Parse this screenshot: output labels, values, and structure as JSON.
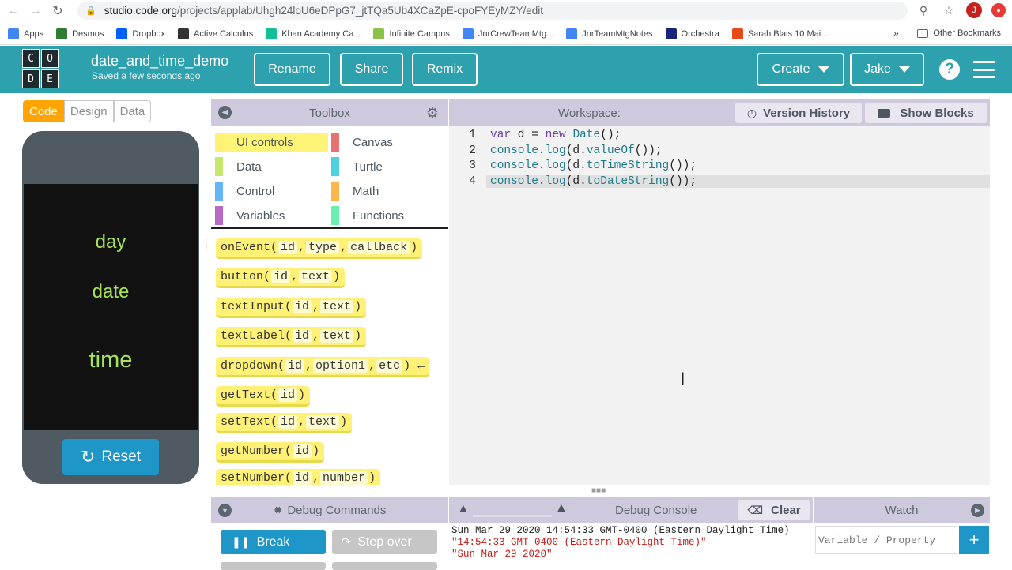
{
  "browser": {
    "url_host": "studio.code.org",
    "url_path": "/projects/applab/Uhgh24loU6eDPpG7_jtTQa5Ub4XCaZpE-cpoFYEyMZY/edit",
    "avatar_letter": "J"
  },
  "bookmarks": [
    {
      "label": "Apps",
      "color": "#4285f4"
    },
    {
      "label": "Desmos",
      "color": "#2e7d32"
    },
    {
      "label": "Dropbox",
      "color": "#0061fe"
    },
    {
      "label": "Active Calculus",
      "color": "#333333"
    },
    {
      "label": "Khan Academy Ca...",
      "color": "#14bf96"
    },
    {
      "label": "Infinite Campus",
      "color": "#8bc34a"
    },
    {
      "label": "JnrCrewTeamMtg...",
      "color": "#4285f4"
    },
    {
      "label": "JnrTeamMtgNotes",
      "color": "#4285f4"
    },
    {
      "label": "Orchestra",
      "color": "#1a237e"
    },
    {
      "label": "Sarah Blais 10 Mai...",
      "color": "#e64a19"
    }
  ],
  "bookmarks_more": "»",
  "other_bookmarks": "Other Bookmarks",
  "app": {
    "logo_letters": [
      "C",
      "O",
      "D",
      "E"
    ],
    "project_name": "date_and_time_demo",
    "saved_status": "Saved a few seconds ago",
    "rename_label": "Rename",
    "share_label": "Share",
    "remix_label": "Remix",
    "create_label": "Create",
    "user_label": "Jake",
    "help_label": "?"
  },
  "mode_tabs": [
    "Code",
    "Design",
    "Data"
  ],
  "phone": {
    "labels": [
      "day",
      "date",
      "time"
    ],
    "reset_label": "Reset"
  },
  "toolbox": {
    "title": "Toolbox",
    "categories": [
      {
        "label": "UI controls",
        "color": "#fff176"
      },
      {
        "label": "Canvas",
        "color": "#e57373"
      },
      {
        "label": "Data",
        "color": "#c5e86c"
      },
      {
        "label": "Turtle",
        "color": "#4dd0e1"
      },
      {
        "label": "Control",
        "color": "#64b5f6"
      },
      {
        "label": "Math",
        "color": "#ffb74d"
      },
      {
        "label": "Variables",
        "color": "#ba68c8"
      },
      {
        "label": "Functions",
        "color": "#69f0ae"
      }
    ],
    "blocks": [
      {
        "fn": "onEvent(",
        "args": [
          "id",
          "type",
          "callback"
        ],
        "end": ")"
      },
      {
        "fn": "button(",
        "args": [
          "id",
          "text"
        ],
        "end": ")"
      },
      {
        "fn": "textInput(",
        "args": [
          "id",
          "text"
        ],
        "end": ")"
      },
      {
        "fn": "textLabel(",
        "args": [
          "id",
          "text"
        ],
        "end": ")"
      },
      {
        "fn": "dropdown(",
        "args": [
          "id",
          "option1",
          "etc"
        ],
        "end": ") ←"
      },
      {
        "fn": "getText(",
        "args": [
          "id"
        ],
        "end": ")"
      },
      {
        "fn": "setText(",
        "args": [
          "id",
          "text"
        ],
        "end": ")"
      },
      {
        "fn": "getNumber(",
        "args": [
          "id"
        ],
        "end": ")"
      },
      {
        "fn": "setNumber(",
        "args": [
          "id",
          "number"
        ],
        "end": ")"
      }
    ]
  },
  "workspace": {
    "title": "Workspace:",
    "version_history_label": "Version History",
    "show_blocks_label": "Show Blocks",
    "lines": [
      {
        "num": "1",
        "text": "var d = new Date();"
      },
      {
        "num": "2",
        "text": "console.log(d.valueOf());"
      },
      {
        "num": "3",
        "text": "console.log(d.toTimeString());"
      },
      {
        "num": "4",
        "text": "console.log(d.toDateString());"
      }
    ]
  },
  "debug_commands": {
    "title": "Debug Commands",
    "break_label": "Break",
    "step_over_label": "Step over"
  },
  "debug_console": {
    "title": "Debug Console",
    "clear_label": "Clear",
    "lines": [
      {
        "text": "Sun Mar 29 2020 14:54:33 GMT-0400 (Eastern Daylight Time)",
        "color": "#222222"
      },
      {
        "text": "\"14:54:33 GMT-0400 (Eastern Daylight Time)\"",
        "color": "#c41a16"
      },
      {
        "text": "\"Sun Mar 29 2020\"",
        "color": "#c41a16"
      }
    ]
  },
  "watch": {
    "title": "Watch",
    "placeholder": "Variable / Property",
    "add_label": "+"
  },
  "colors": {
    "header_teal": "#2ea1ae",
    "panel_header": "#cfc9de",
    "code_tab_orange": "#ffa400",
    "reset_blue": "#1e96c8",
    "label_green": "#a8e25a"
  }
}
